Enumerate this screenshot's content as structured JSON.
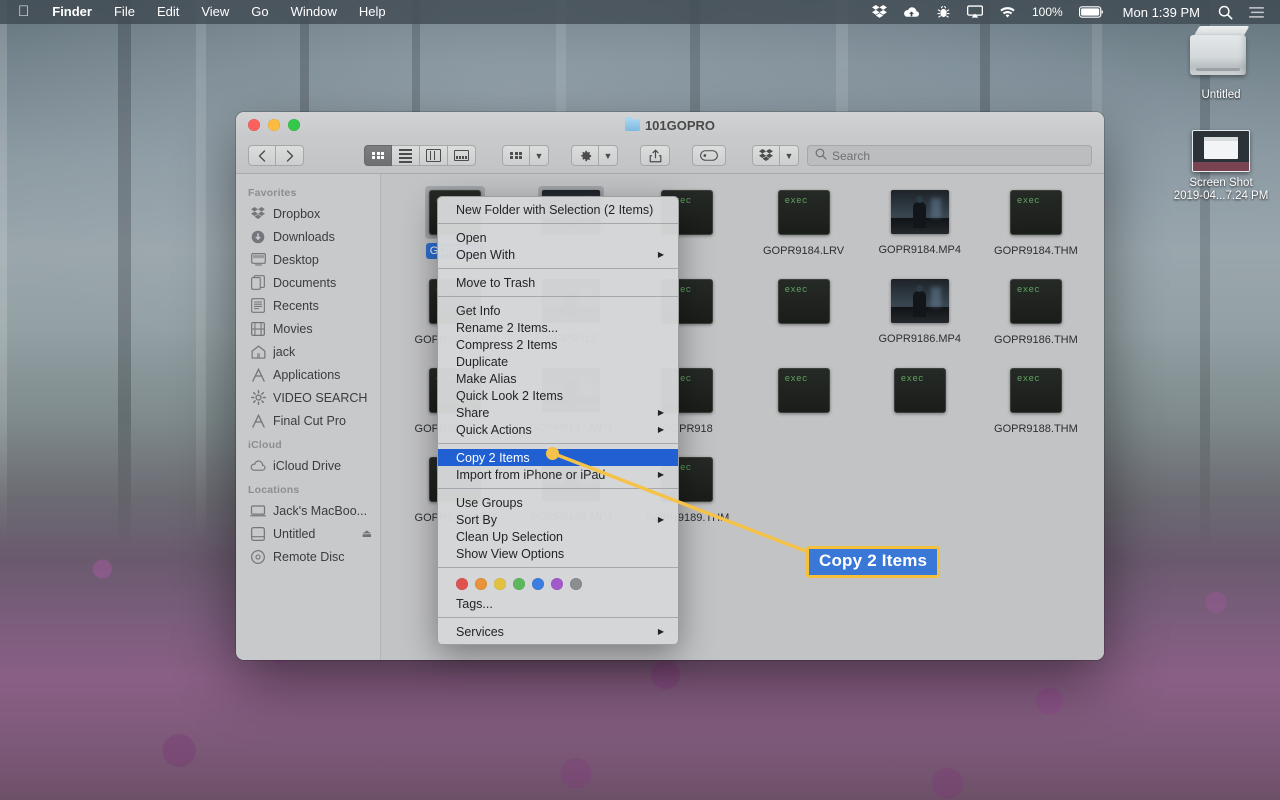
{
  "menubar": {
    "apple_icon": "apple-logo-icon",
    "items": [
      "Finder",
      "File",
      "Edit",
      "View",
      "Go",
      "Window",
      "Help"
    ],
    "status_icons": [
      "dropbox-icon",
      "cloud-icon",
      "bug-icon",
      "airplay-icon",
      "wifi-icon"
    ],
    "battery_percent": "100%",
    "clock": "Mon 1:39 PM",
    "right_icons": [
      "search-icon",
      "control-center-icon"
    ]
  },
  "desktop_icons": [
    {
      "name": "Untitled",
      "type": "hard-drive",
      "label": "Untitled"
    },
    {
      "name": "Screen Shot",
      "type": "screenshot",
      "label_line1": "Screen Shot",
      "label_line2": "2019-04...7.24 PM"
    }
  ],
  "finder": {
    "title": "101GOPRO",
    "traffic_lights": [
      "close-button",
      "minimize-button",
      "zoom-button"
    ],
    "toolbar": {
      "back_label": "‹",
      "forward_label": "›",
      "view_buttons": [
        "icon-view",
        "list-view",
        "column-view",
        "gallery-view"
      ],
      "active_view": "icon-view",
      "group_button": "group-items-button",
      "action_button": "action-gear-button",
      "share_button": "share-button",
      "tag_button": "tag-button",
      "dropbox_button": "dropbox-share-button",
      "search_placeholder": "Search"
    },
    "sidebar": {
      "sections": [
        {
          "title": "Favorites",
          "items": [
            {
              "label": "Dropbox",
              "icon": "dropbox-icon"
            },
            {
              "label": "Downloads",
              "icon": "download-icon"
            },
            {
              "label": "Desktop",
              "icon": "desktop-icon"
            },
            {
              "label": "Documents",
              "icon": "documents-icon"
            },
            {
              "label": "Recents",
              "icon": "recents-icon"
            },
            {
              "label": "Movies",
              "icon": "movies-icon"
            },
            {
              "label": "jack",
              "icon": "home-icon"
            },
            {
              "label": "Applications",
              "icon": "applications-icon"
            },
            {
              "label": "VIDEO SEARCH",
              "icon": "gear-icon"
            },
            {
              "label": "Final Cut Pro",
              "icon": "applications-icon"
            }
          ]
        },
        {
          "title": "iCloud",
          "items": [
            {
              "label": "iCloud Drive",
              "icon": "cloud-icon"
            }
          ]
        },
        {
          "title": "Locations",
          "items": [
            {
              "label": "Jack's MacBoo...",
              "icon": "laptop-icon"
            },
            {
              "label": "Untitled",
              "icon": "drive-icon",
              "eject": "⏏"
            },
            {
              "label": "Remote Disc",
              "icon": "disc-icon"
            }
          ]
        }
      ]
    },
    "files": [
      {
        "label": "GOPR918",
        "icon": "exec",
        "selected": true,
        "truncated": true
      },
      {
        "label": "",
        "icon": "video",
        "selected": false,
        "hidden_label": true
      },
      {
        "label": "",
        "icon": "exec",
        "selected": false,
        "hidden_label": true
      },
      {
        "label": "GOPR9184.LRV",
        "icon": "exec",
        "selected": false
      },
      {
        "label": "GOPR9184.MP4",
        "icon": "video",
        "selected": false
      },
      {
        "label": "GOPR9184.THM",
        "icon": "exec",
        "selected": false
      },
      {
        "label": "GOPR9185.LRV",
        "icon": "exec",
        "selected": false
      },
      {
        "label": "GOPR918",
        "icon": "video",
        "selected": false,
        "truncated": true
      },
      {
        "label": "",
        "icon": "exec",
        "selected": false,
        "hidden_label": true
      },
      {
        "label": "",
        "icon": "exec",
        "selected": false,
        "hidden_label": true
      },
      {
        "label": "GOPR9186.MP4",
        "icon": "video",
        "selected": false
      },
      {
        "label": "GOPR9186.THM",
        "icon": "exec",
        "selected": false
      },
      {
        "label": "GOPR9187.LRV",
        "icon": "exec",
        "selected": false
      },
      {
        "label": "GOPR9187.MP4",
        "icon": "video",
        "selected": false
      },
      {
        "label": "GOPR918",
        "icon": "exec",
        "selected": false,
        "truncated": true
      },
      {
        "label": "",
        "icon": "exec",
        "selected": false,
        "hidden_label": true
      },
      {
        "label": "",
        "icon": "exec",
        "selected": false,
        "hidden_label": true
      },
      {
        "label": "GOPR9188.THM",
        "icon": "exec",
        "selected": false
      },
      {
        "label": "GOPR9189.LRV",
        "icon": "exec",
        "selected": false
      },
      {
        "label": "GOPR9189.MP4",
        "icon": "video",
        "selected": false
      },
      {
        "label": "GOPR9189.THM",
        "icon": "exec",
        "selected": false
      }
    ],
    "exec_icon_text": "exec"
  },
  "context_menu": {
    "groups": [
      [
        {
          "label": "New Folder with Selection (2 Items)",
          "submenu": false
        }
      ],
      [
        {
          "label": "Open",
          "submenu": false
        },
        {
          "label": "Open With",
          "submenu": true
        }
      ],
      [
        {
          "label": "Move to Trash",
          "submenu": false
        }
      ],
      [
        {
          "label": "Get Info",
          "submenu": false
        },
        {
          "label": "Rename 2 Items...",
          "submenu": false
        },
        {
          "label": "Compress 2 Items",
          "submenu": false
        },
        {
          "label": "Duplicate",
          "submenu": false
        },
        {
          "label": "Make Alias",
          "submenu": false
        },
        {
          "label": "Quick Look 2 Items",
          "submenu": false
        },
        {
          "label": "Share",
          "submenu": true
        },
        {
          "label": "Quick Actions",
          "submenu": true
        }
      ],
      [
        {
          "label": "Copy 2 Items",
          "submenu": false,
          "highlighted": true
        },
        {
          "label": "Import from iPhone or iPad",
          "submenu": true
        }
      ],
      [
        {
          "label": "Use Groups",
          "submenu": false
        },
        {
          "label": "Sort By",
          "submenu": true
        },
        {
          "label": "Clean Up Selection",
          "submenu": false
        },
        {
          "label": "Show View Options",
          "submenu": false
        }
      ]
    ],
    "tags": {
      "colors": [
        "#e0524d",
        "#e8923a",
        "#e3c140",
        "#5cb85c",
        "#3b7de0",
        "#a259cc",
        "#8b8e91"
      ],
      "label": "Tags..."
    },
    "services": {
      "label": "Services",
      "submenu": true
    },
    "highlight_color": "#2160d2"
  },
  "annotation": {
    "callout_text": "Copy 2 Items",
    "border_color": "#f5bf3e",
    "fill_color": "#3a78d8",
    "line_color": "#f5c24a",
    "dot_color": "#f5c24a"
  }
}
